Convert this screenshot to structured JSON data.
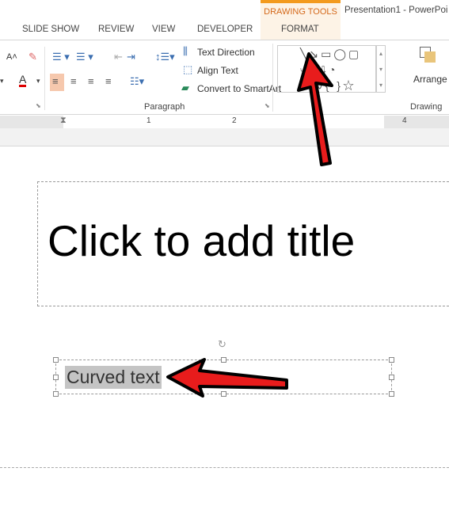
{
  "window": {
    "title": "Presentation1 - PowerPoi"
  },
  "ribbon": {
    "contextual_group": "DRAWING TOOLS",
    "tabs": [
      {
        "label": "SLIDE SHOW"
      },
      {
        "label": "REVIEW"
      },
      {
        "label": "VIEW"
      },
      {
        "label": "DEVELOPER"
      },
      {
        "label": "FORMAT",
        "active": true
      }
    ],
    "paragraph": {
      "text_direction": "Text Direction",
      "align_text": "Align Text",
      "convert_smartart": "Convert to SmartArt",
      "group_label": "Paragraph"
    },
    "drawing": {
      "arrange": "Arrange",
      "group_label": "Drawing"
    }
  },
  "ruler": {
    "labels": [
      "1",
      "2",
      "4"
    ]
  },
  "slide": {
    "title_placeholder": "Click to add title",
    "textbox_text": "Curved text"
  },
  "colors": {
    "accent": "#f39a1e",
    "arrow": "#e81c1c",
    "selection": "#c4c4c4"
  }
}
